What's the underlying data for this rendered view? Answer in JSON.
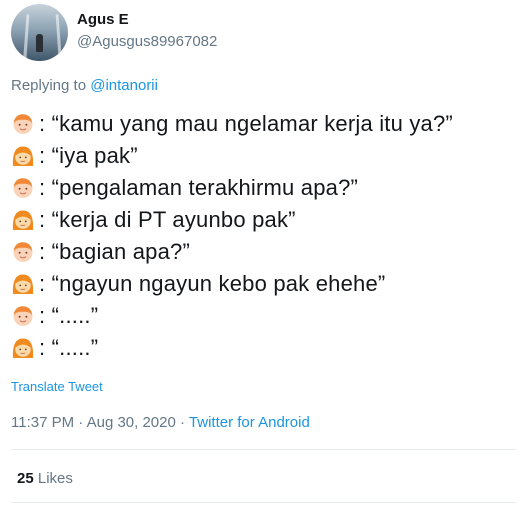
{
  "user": {
    "name": "Agus E",
    "handle": "@Agusgus89967082"
  },
  "reply": {
    "prefix": "Replying to ",
    "to": "@intanorii"
  },
  "lines": [
    {
      "speaker": "man",
      "text": ": “kamu yang mau ngelamar kerja itu ya?”"
    },
    {
      "speaker": "woman",
      "text": ": “iya pak”"
    },
    {
      "speaker": "man",
      "text": ": “pengalaman terakhirmu apa?”"
    },
    {
      "speaker": "woman",
      "text": ": “kerja di PT ayunbo pak”"
    },
    {
      "speaker": "man",
      "text": ": “bagian apa?”"
    },
    {
      "speaker": "woman",
      "text": ": “ngayun ngayun kebo pak ehehe”"
    },
    {
      "speaker": "man",
      "text": ": “.....”"
    },
    {
      "speaker": "woman",
      "text": ": “.....”"
    }
  ],
  "translate": "Translate Tweet",
  "meta": {
    "time": "11:37 PM · Aug 30, 2020 · ",
    "source": "Twitter for Android"
  },
  "likes": {
    "count": "25",
    "label": " Likes"
  },
  "icons": {
    "man": "man-face-emoji-icon",
    "woman": "woman-red-hair-emoji-icon"
  },
  "colors": {
    "link": "#1b95e0",
    "secondary": "#657786",
    "text": "#14171a"
  }
}
